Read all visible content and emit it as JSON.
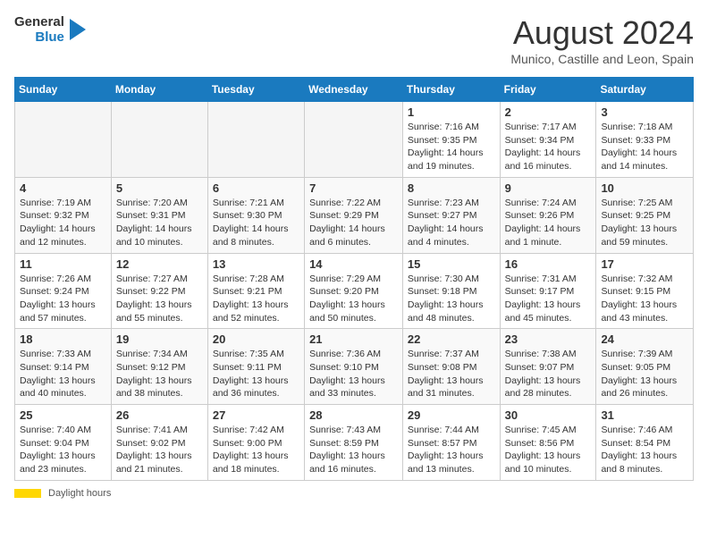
{
  "header": {
    "logo_line1": "General",
    "logo_line2": "Blue",
    "title": "August 2024",
    "location": "Munico, Castille and Leon, Spain"
  },
  "weekdays": [
    "Sunday",
    "Monday",
    "Tuesday",
    "Wednesday",
    "Thursday",
    "Friday",
    "Saturday"
  ],
  "weeks": [
    [
      {
        "day": "",
        "info": ""
      },
      {
        "day": "",
        "info": ""
      },
      {
        "day": "",
        "info": ""
      },
      {
        "day": "",
        "info": ""
      },
      {
        "day": "1",
        "info": "Sunrise: 7:16 AM\nSunset: 9:35 PM\nDaylight: 14 hours\nand 19 minutes."
      },
      {
        "day": "2",
        "info": "Sunrise: 7:17 AM\nSunset: 9:34 PM\nDaylight: 14 hours\nand 16 minutes."
      },
      {
        "day": "3",
        "info": "Sunrise: 7:18 AM\nSunset: 9:33 PM\nDaylight: 14 hours\nand 14 minutes."
      }
    ],
    [
      {
        "day": "4",
        "info": "Sunrise: 7:19 AM\nSunset: 9:32 PM\nDaylight: 14 hours\nand 12 minutes."
      },
      {
        "day": "5",
        "info": "Sunrise: 7:20 AM\nSunset: 9:31 PM\nDaylight: 14 hours\nand 10 minutes."
      },
      {
        "day": "6",
        "info": "Sunrise: 7:21 AM\nSunset: 9:30 PM\nDaylight: 14 hours\nand 8 minutes."
      },
      {
        "day": "7",
        "info": "Sunrise: 7:22 AM\nSunset: 9:29 PM\nDaylight: 14 hours\nand 6 minutes."
      },
      {
        "day": "8",
        "info": "Sunrise: 7:23 AM\nSunset: 9:27 PM\nDaylight: 14 hours\nand 4 minutes."
      },
      {
        "day": "9",
        "info": "Sunrise: 7:24 AM\nSunset: 9:26 PM\nDaylight: 14 hours\nand 1 minute."
      },
      {
        "day": "10",
        "info": "Sunrise: 7:25 AM\nSunset: 9:25 PM\nDaylight: 13 hours\nand 59 minutes."
      }
    ],
    [
      {
        "day": "11",
        "info": "Sunrise: 7:26 AM\nSunset: 9:24 PM\nDaylight: 13 hours\nand 57 minutes."
      },
      {
        "day": "12",
        "info": "Sunrise: 7:27 AM\nSunset: 9:22 PM\nDaylight: 13 hours\nand 55 minutes."
      },
      {
        "day": "13",
        "info": "Sunrise: 7:28 AM\nSunset: 9:21 PM\nDaylight: 13 hours\nand 52 minutes."
      },
      {
        "day": "14",
        "info": "Sunrise: 7:29 AM\nSunset: 9:20 PM\nDaylight: 13 hours\nand 50 minutes."
      },
      {
        "day": "15",
        "info": "Sunrise: 7:30 AM\nSunset: 9:18 PM\nDaylight: 13 hours\nand 48 minutes."
      },
      {
        "day": "16",
        "info": "Sunrise: 7:31 AM\nSunset: 9:17 PM\nDaylight: 13 hours\nand 45 minutes."
      },
      {
        "day": "17",
        "info": "Sunrise: 7:32 AM\nSunset: 9:15 PM\nDaylight: 13 hours\nand 43 minutes."
      }
    ],
    [
      {
        "day": "18",
        "info": "Sunrise: 7:33 AM\nSunset: 9:14 PM\nDaylight: 13 hours\nand 40 minutes."
      },
      {
        "day": "19",
        "info": "Sunrise: 7:34 AM\nSunset: 9:12 PM\nDaylight: 13 hours\nand 38 minutes."
      },
      {
        "day": "20",
        "info": "Sunrise: 7:35 AM\nSunset: 9:11 PM\nDaylight: 13 hours\nand 36 minutes."
      },
      {
        "day": "21",
        "info": "Sunrise: 7:36 AM\nSunset: 9:10 PM\nDaylight: 13 hours\nand 33 minutes."
      },
      {
        "day": "22",
        "info": "Sunrise: 7:37 AM\nSunset: 9:08 PM\nDaylight: 13 hours\nand 31 minutes."
      },
      {
        "day": "23",
        "info": "Sunrise: 7:38 AM\nSunset: 9:07 PM\nDaylight: 13 hours\nand 28 minutes."
      },
      {
        "day": "24",
        "info": "Sunrise: 7:39 AM\nSunset: 9:05 PM\nDaylight: 13 hours\nand 26 minutes."
      }
    ],
    [
      {
        "day": "25",
        "info": "Sunrise: 7:40 AM\nSunset: 9:04 PM\nDaylight: 13 hours\nand 23 minutes."
      },
      {
        "day": "26",
        "info": "Sunrise: 7:41 AM\nSunset: 9:02 PM\nDaylight: 13 hours\nand 21 minutes."
      },
      {
        "day": "27",
        "info": "Sunrise: 7:42 AM\nSunset: 9:00 PM\nDaylight: 13 hours\nand 18 minutes."
      },
      {
        "day": "28",
        "info": "Sunrise: 7:43 AM\nSunset: 8:59 PM\nDaylight: 13 hours\nand 16 minutes."
      },
      {
        "day": "29",
        "info": "Sunrise: 7:44 AM\nSunset: 8:57 PM\nDaylight: 13 hours\nand 13 minutes."
      },
      {
        "day": "30",
        "info": "Sunrise: 7:45 AM\nSunset: 8:56 PM\nDaylight: 13 hours\nand 10 minutes."
      },
      {
        "day": "31",
        "info": "Sunrise: 7:46 AM\nSunset: 8:54 PM\nDaylight: 13 hours\nand 8 minutes."
      }
    ]
  ],
  "footer": {
    "bar_label": "Daylight hours"
  }
}
